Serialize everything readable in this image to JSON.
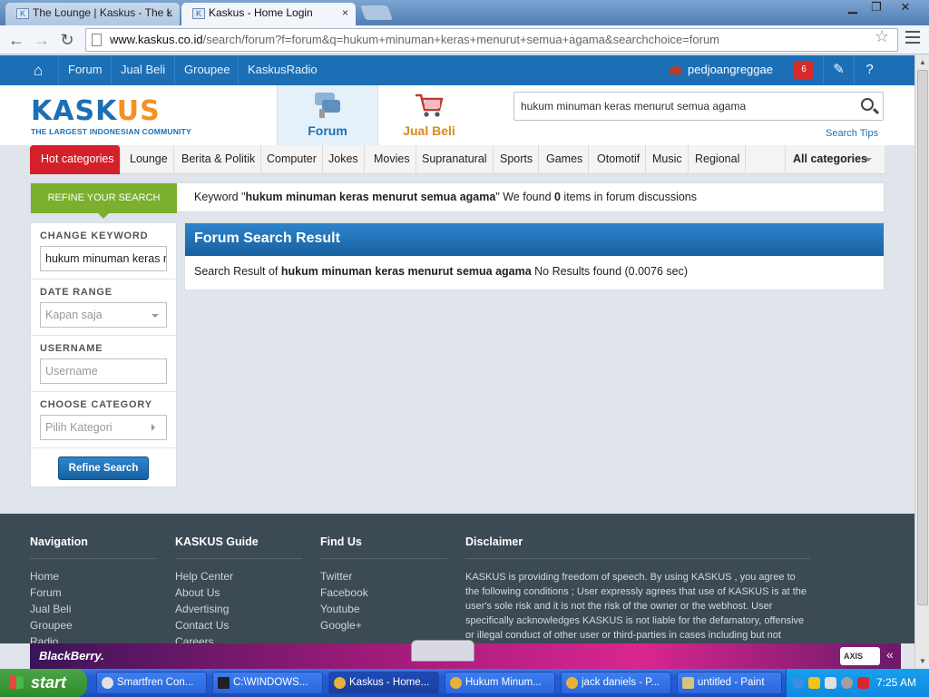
{
  "browser": {
    "tabs": [
      {
        "title": "The Lounge | Kaskus - The L"
      },
      {
        "title": "Kaskus - Home Login"
      }
    ],
    "close_glyph": "×",
    "url_host": "www.kaskus.co.id",
    "url_path": "/search/forum?f=forum&q=hukum+minuman+keras+menurut+semua+agama&searchchoice=forum",
    "icons": [
      "back-icon",
      "forward-icon",
      "reload-icon",
      "star-icon",
      "menu-icon"
    ]
  },
  "topnav": {
    "items": [
      "Forum",
      "Jual Beli",
      "Groupee",
      "KaskusRadio"
    ],
    "username": "pedjoangreggae",
    "notification_count": "6"
  },
  "header": {
    "logo_text_a": "KASK",
    "logo_text_o": "US",
    "logo_tagline": "THE LARGEST INDONESIAN COMMUNITY",
    "tab_forum": "Forum",
    "tab_jualbeli": "Jual Beli",
    "search_value": "hukum minuman keras menurut semua agama",
    "search_tips": "Search Tips"
  },
  "categories": {
    "hot": "Hot categories",
    "items": [
      "Lounge",
      "Berita & Politik",
      "Computer",
      "Jokes",
      "Movies",
      "Supranatural",
      "Sports",
      "Games",
      "Otomotif",
      "Music",
      "Regional"
    ],
    "all": "All categories"
  },
  "refine": {
    "tab_label": "REFINE YOUR SEARCH",
    "kw_prefix": "Keyword \"",
    "keyword": "hukum minuman keras menurut semua agama",
    "kw_mid": "\" We found ",
    "count": "0",
    "kw_suffix": " items in forum discussions"
  },
  "filter": {
    "change_keyword_label": "CHANGE KEYWORD",
    "keyword_value": "hukum minuman keras menurut semua agama",
    "date_range_label": "DATE RANGE",
    "date_range_value": "Kapan saja",
    "username_label": "USERNAME",
    "username_placeholder": "Username",
    "category_label": "CHOOSE CATEGORY",
    "category_value": "Pilih Kategori",
    "refine_button": "Refine Search"
  },
  "results": {
    "title": "Forum Search Result",
    "prefix": "Search Result of ",
    "keyword": "hukum minuman keras menurut semua agama",
    "suffix": " No Results found (0.0076 sec)"
  },
  "footer": {
    "navigation_title": "Navigation",
    "navigation": [
      "Home",
      "Forum",
      "Jual Beli",
      "Groupee",
      "Radio"
    ],
    "guide_title": "KASKUS Guide",
    "guide": [
      "Help Center",
      "About Us",
      "Advertising",
      "Contact Us",
      "Careers"
    ],
    "findus_title": "Find Us",
    "findus": [
      "Twitter",
      "Facebook",
      "Youtube",
      "Google+"
    ],
    "disclaimer_title": "Disclaimer",
    "disclaimer_text": "KASKUS is providing freedom of speech. By using KASKUS , you agree to the following conditions ; User expressly agrees that use of KASKUS is at the user's sole risk and it is not the risk of the owner or the webhost. User specifically acknowledges KASKUS is not liable for the defamatory, offensive or illegal conduct of other user or third-parties in cases including but not limited"
  },
  "ad": {
    "brand": "BlackBerry.",
    "partner": "AXIS"
  },
  "taskbar": {
    "start": "start",
    "tasks": [
      "Smartfren Con...",
      "C:\\WINDOWS...",
      "Kaskus - Home...",
      "Hukum Minum...",
      "jack daniels - P...",
      "untitled - Paint"
    ],
    "clock": "7:25 AM"
  },
  "colors": {
    "brand_blue": "#1c6fb5",
    "hot_red": "#d3202a",
    "refine_green": "#7ab02e",
    "footer_bg": "#3c4a54",
    "jualbeli_orange": "#d88a1a"
  }
}
